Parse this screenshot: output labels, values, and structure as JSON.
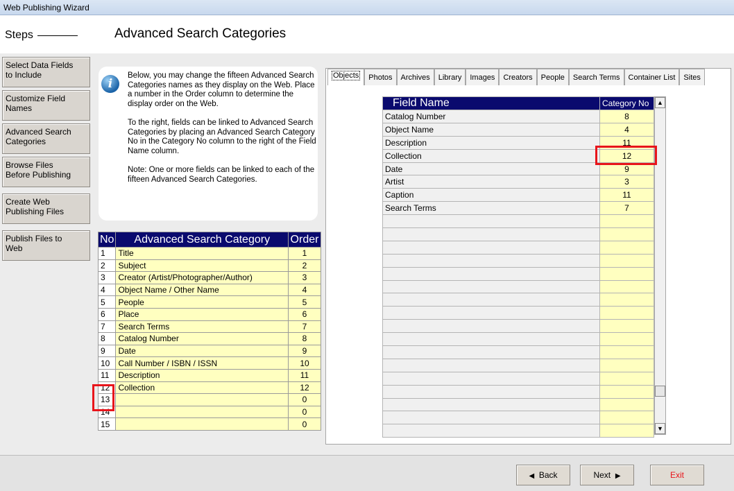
{
  "window": {
    "title": "Web Publishing Wizard"
  },
  "sidebar": {
    "heading": "Steps",
    "items": [
      {
        "label": "Select Data Fields\nto Include"
      },
      {
        "label": "Customize Field\nNames"
      },
      {
        "label": "Advanced Search\nCategories"
      },
      {
        "label": "Browse Files\nBefore Publishing"
      },
      {
        "label": "Create Web\nPublishing Files"
      },
      {
        "label": "Publish Files to\nWeb"
      }
    ]
  },
  "main": {
    "title": "Advanced Search Categories",
    "info_text": "Below, you may change the fifteen Advanced Search Categories names as they display on the Web.   Place a number in the Order column to determine the display order on the Web.\n\nTo the right, fields can be linked to Advanced Search Categories by placing an Advanced Search Category No in the Category No column to the right of the Field Name column.\n\nNote: One or more fields can be linked to each of the fifteen Advanced Search Categories."
  },
  "categories_table": {
    "headers": {
      "no": "No",
      "name": "Advanced Search Category",
      "order": "Order"
    },
    "rows": [
      {
        "no": "1",
        "name": "Title",
        "order": "1"
      },
      {
        "no": "2",
        "name": "Subject",
        "order": "2"
      },
      {
        "no": "3",
        "name": "Creator (Artist/Photographer/Author)",
        "order": "3"
      },
      {
        "no": "4",
        "name": "Object Name / Other Name",
        "order": "4"
      },
      {
        "no": "5",
        "name": "People",
        "order": "5"
      },
      {
        "no": "6",
        "name": "Place",
        "order": "6"
      },
      {
        "no": "7",
        "name": "Search Terms",
        "order": "7"
      },
      {
        "no": "8",
        "name": "Catalog Number",
        "order": "8"
      },
      {
        "no": "9",
        "name": "Date",
        "order": "9"
      },
      {
        "no": "10",
        "name": "Call Number / ISBN / ISSN",
        "order": "10"
      },
      {
        "no": "11",
        "name": "Description",
        "order": "11"
      },
      {
        "no": "12",
        "name": "Collection",
        "order": "12"
      },
      {
        "no": "13",
        "name": "",
        "order": "0"
      },
      {
        "no": "14",
        "name": "",
        "order": "0"
      },
      {
        "no": "15",
        "name": "",
        "order": "0"
      }
    ]
  },
  "tabs": [
    {
      "label": "Objects",
      "active": true
    },
    {
      "label": "Photos"
    },
    {
      "label": "Archives"
    },
    {
      "label": "Library"
    },
    {
      "label": "Images"
    },
    {
      "label": "Creators"
    },
    {
      "label": "People"
    },
    {
      "label": "Search Terms"
    },
    {
      "label": "Container List"
    },
    {
      "label": "Sites"
    }
  ],
  "fields_table": {
    "headers": {
      "field_name": "Field Name",
      "category_no": "Category No"
    },
    "rows": [
      {
        "field": "Catalog Number",
        "cat": "8"
      },
      {
        "field": "Object Name",
        "cat": "4"
      },
      {
        "field": "Description",
        "cat": "11"
      },
      {
        "field": "Collection",
        "cat": "12"
      },
      {
        "field": "Date",
        "cat": "9"
      },
      {
        "field": "Artist",
        "cat": "3"
      },
      {
        "field": "Caption",
        "cat": "11"
      },
      {
        "field": "Search Terms",
        "cat": "7"
      },
      {
        "field": "",
        "cat": ""
      },
      {
        "field": "",
        "cat": ""
      },
      {
        "field": "",
        "cat": ""
      },
      {
        "field": "",
        "cat": ""
      },
      {
        "field": "",
        "cat": ""
      },
      {
        "field": "",
        "cat": ""
      },
      {
        "field": "",
        "cat": ""
      },
      {
        "field": "",
        "cat": ""
      },
      {
        "field": "",
        "cat": ""
      },
      {
        "field": "",
        "cat": ""
      },
      {
        "field": "",
        "cat": ""
      },
      {
        "field": "",
        "cat": ""
      },
      {
        "field": "",
        "cat": ""
      },
      {
        "field": "",
        "cat": ""
      },
      {
        "field": "",
        "cat": ""
      },
      {
        "field": "",
        "cat": ""
      },
      {
        "field": "",
        "cat": ""
      }
    ]
  },
  "footer": {
    "back_label": "Back",
    "next_label": "Next",
    "exit_label": "Exit"
  },
  "colors": {
    "header_navy": "#0a0a6e",
    "cell_yellow": "#ffffc0",
    "highlight_red": "#e8151b",
    "exit_red": "#e8151b"
  },
  "icons": [
    "info-icon",
    "arrow-left-icon",
    "arrow-right-icon",
    "scroll-up-icon",
    "scroll-down-icon"
  ]
}
